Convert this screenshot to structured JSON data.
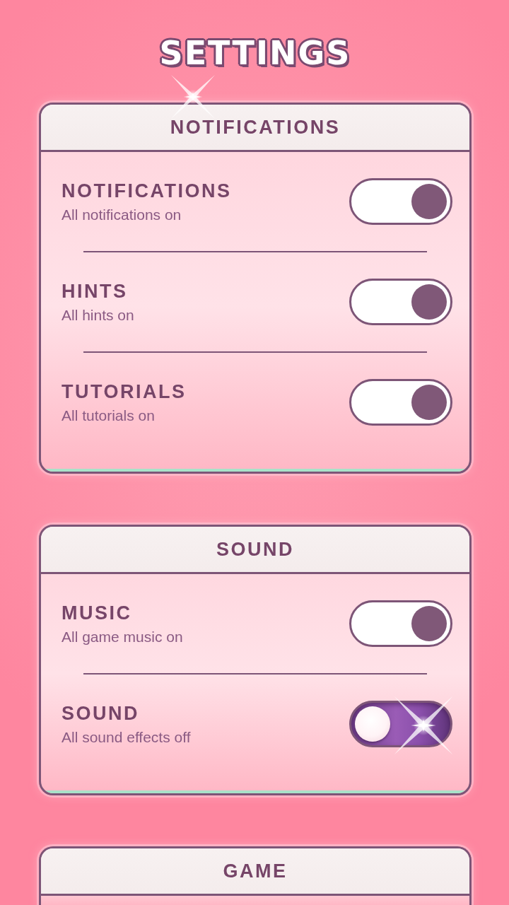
{
  "title": "SETTINGS",
  "sections": [
    {
      "title": "NOTIFICATIONS",
      "rows": [
        {
          "title": "NOTIFICATIONS",
          "subtitle": "All notifications on",
          "on": true
        },
        {
          "title": "HINTS",
          "subtitle": "All hints on",
          "on": true
        },
        {
          "title": "TUTORIALS",
          "subtitle": "All tutorials on",
          "on": true
        }
      ]
    },
    {
      "title": "SOUND",
      "rows": [
        {
          "title": "MUSIC",
          "subtitle": "All game music on",
          "on": true
        },
        {
          "title": "SOUND",
          "subtitle": "All sound effects off",
          "on": false
        }
      ]
    },
    {
      "title": "GAME"
    }
  ]
}
